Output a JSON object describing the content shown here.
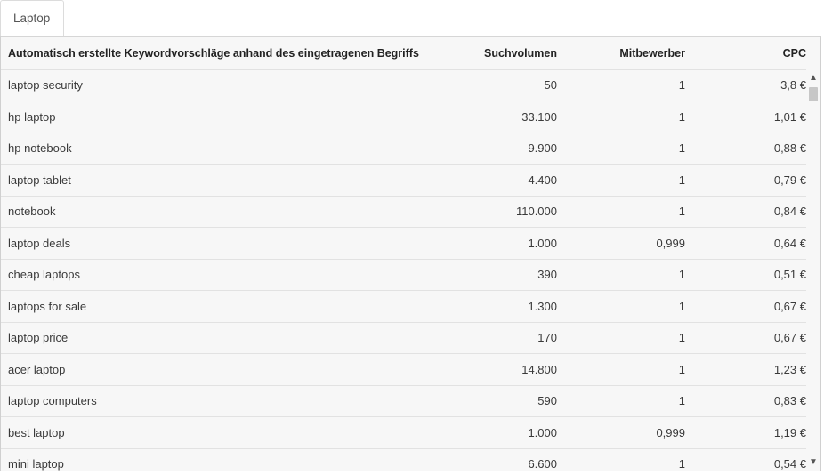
{
  "tab": {
    "label": "Laptop"
  },
  "table": {
    "headers": {
      "keyword": "Automatisch erstellte Keywordvorschläge anhand des eingetragenen Begriffs",
      "volume": "Suchvolumen",
      "competitors": "Mitbewerber",
      "cpc": "CPC"
    },
    "rows": [
      {
        "keyword": "laptop security",
        "volume": "50",
        "competitors": "1",
        "cpc": "3,8 €"
      },
      {
        "keyword": "hp laptop",
        "volume": "33.100",
        "competitors": "1",
        "cpc": "1,01 €"
      },
      {
        "keyword": "hp notebook",
        "volume": "9.900",
        "competitors": "1",
        "cpc": "0,88 €"
      },
      {
        "keyword": "laptop tablet",
        "volume": "4.400",
        "competitors": "1",
        "cpc": "0,79 €"
      },
      {
        "keyword": "notebook",
        "volume": "110.000",
        "competitors": "1",
        "cpc": "0,84 €"
      },
      {
        "keyword": "laptop deals",
        "volume": "1.000",
        "competitors": "0,999",
        "cpc": "0,64 €"
      },
      {
        "keyword": "cheap laptops",
        "volume": "390",
        "competitors": "1",
        "cpc": "0,51 €"
      },
      {
        "keyword": "laptops for sale",
        "volume": "1.300",
        "competitors": "1",
        "cpc": "0,67 €"
      },
      {
        "keyword": "laptop price",
        "volume": "170",
        "competitors": "1",
        "cpc": "0,67 €"
      },
      {
        "keyword": "acer laptop",
        "volume": "14.800",
        "competitors": "1",
        "cpc": "1,23 €"
      },
      {
        "keyword": "laptop computers",
        "volume": "590",
        "competitors": "1",
        "cpc": "0,83 €"
      },
      {
        "keyword": "best laptop",
        "volume": "1.000",
        "competitors": "0,999",
        "cpc": "1,19 €"
      },
      {
        "keyword": "mini laptop",
        "volume": "6.600",
        "competitors": "1",
        "cpc": "0,54 €"
      }
    ]
  },
  "scrollbar": {
    "up_icon": "chevron-up-icon",
    "down_icon": "chevron-down-icon"
  }
}
